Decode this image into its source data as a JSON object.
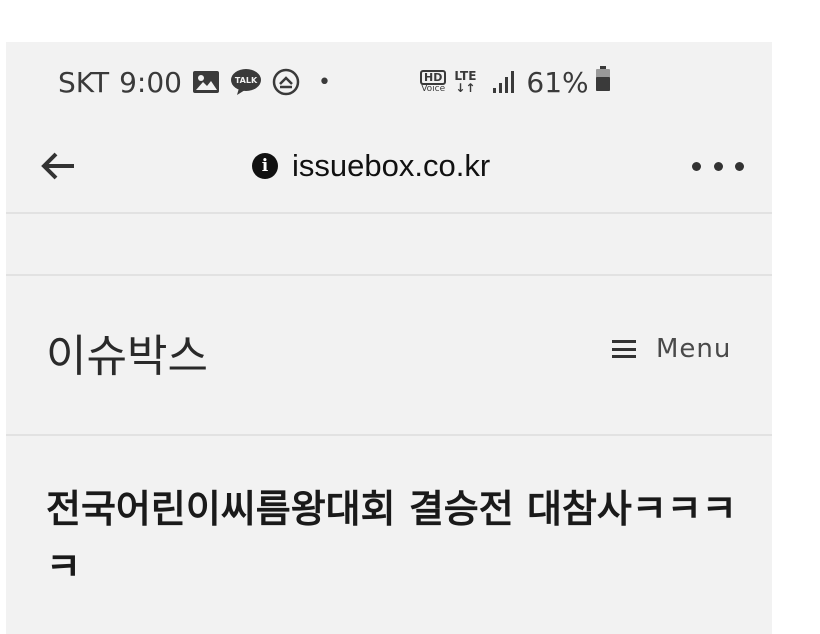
{
  "status_bar": {
    "carrier": "SKT",
    "time": "9:00",
    "left_icons": [
      "image-icon",
      "kakaotalk-icon",
      "data-saver-icon",
      "notification-dot-icon"
    ],
    "kakaotalk_label": "TALK",
    "hd_label": "HD",
    "voice_label": "Voice",
    "lte_label": "LTE",
    "signal_icon": "signal-bars-icon",
    "battery_percent": "61%",
    "battery_icon": "battery-icon"
  },
  "browser": {
    "url": "issuebox.co.kr",
    "info_icon": "info-icon",
    "info_glyph": "i",
    "back_icon": "back-arrow-icon",
    "more_icon": "more-dots-icon"
  },
  "site": {
    "title": "이슈박스",
    "menu_label": "Menu",
    "menu_icon": "hamburger-icon"
  },
  "article": {
    "title": "전국어린이씨름왕대회 결승전 대참사ㅋㅋㅋㅋ"
  },
  "colors": {
    "background": "#f2f2f2",
    "text": "#1e1e1e",
    "divider": "#e2e2e2"
  }
}
